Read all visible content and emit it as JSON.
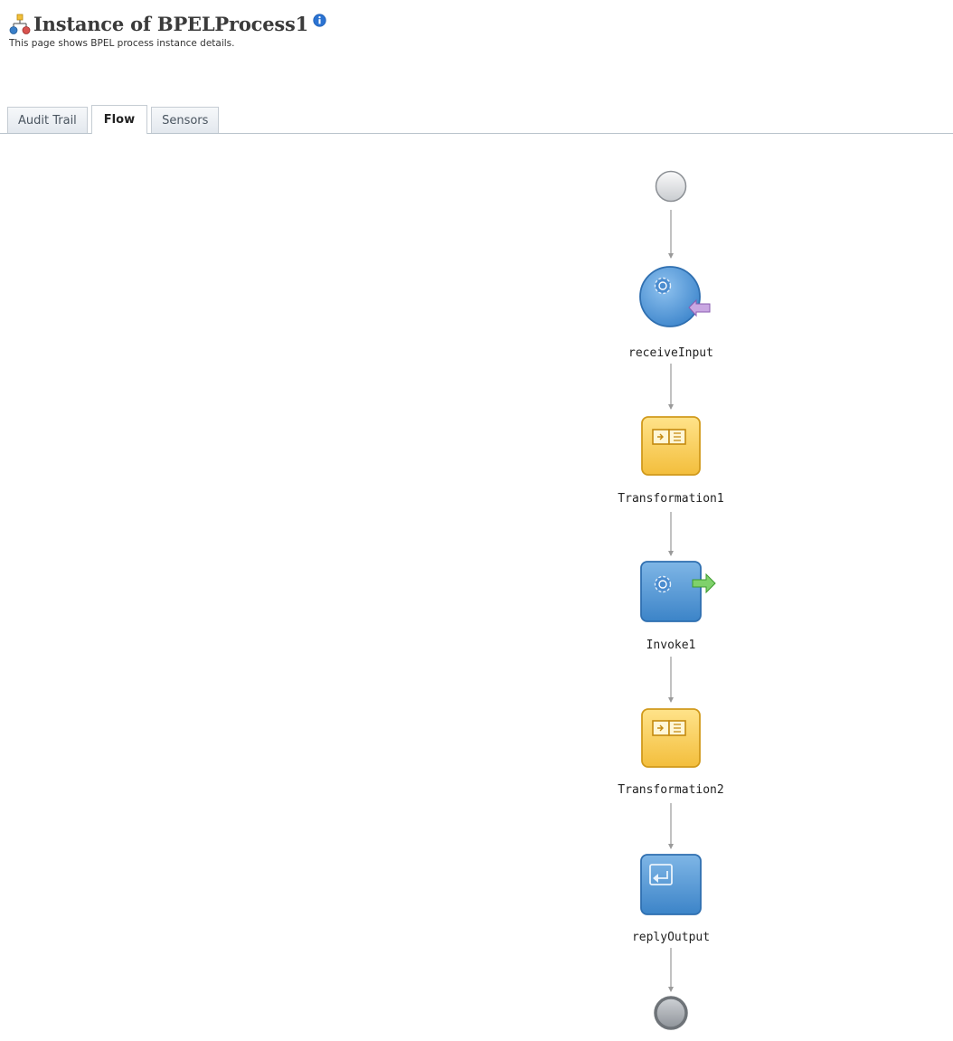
{
  "header": {
    "title": "Instance of BPELProcess1",
    "subtitle": "This page shows BPEL process instance details."
  },
  "tabs": [
    {
      "label": "Audit Trail",
      "active": false
    },
    {
      "label": "Flow",
      "active": true
    },
    {
      "label": "Sensors",
      "active": false
    }
  ],
  "flow": {
    "nodes": [
      {
        "id": "start",
        "kind": "start",
        "label": ""
      },
      {
        "id": "receiveInput",
        "kind": "receive",
        "label": "receiveInput"
      },
      {
        "id": "Transformation1",
        "kind": "transform",
        "label": "Transformation1"
      },
      {
        "id": "Invoke1",
        "kind": "invoke",
        "label": "Invoke1"
      },
      {
        "id": "Transformation2",
        "kind": "transform",
        "label": "Transformation2"
      },
      {
        "id": "replyOutput",
        "kind": "reply",
        "label": "replyOutput"
      },
      {
        "id": "end",
        "kind": "end",
        "label": ""
      }
    ]
  }
}
